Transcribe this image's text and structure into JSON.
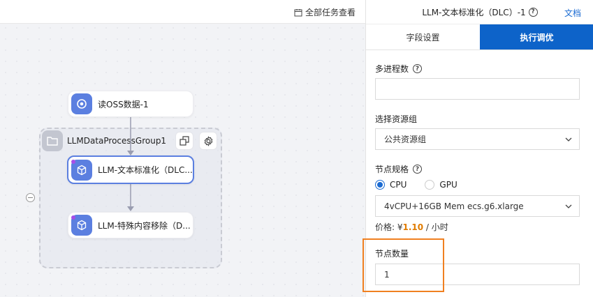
{
  "topbar": {
    "all_tasks": "全部任务查看"
  },
  "canvas": {
    "nodes": [
      {
        "label": "读OSS数据-1"
      },
      {
        "label": "LLM-文本标准化（DLC..."
      },
      {
        "label": "LLM-特殊内容移除（D..."
      }
    ],
    "group": {
      "title": "LLMDataProcessGroup1"
    }
  },
  "panel": {
    "title": "LLM-文本标准化（DLC）-1",
    "doc_link": "文档",
    "tabs": [
      {
        "label": "字段设置",
        "active": false
      },
      {
        "label": "执行调优",
        "active": true
      }
    ],
    "processes": {
      "label": "多进程数",
      "value": ""
    },
    "resource_group": {
      "label": "选择资源组",
      "value": "公共资源组"
    },
    "node_spec": {
      "label": "节点规格",
      "options": [
        "CPU",
        "GPU"
      ],
      "selected": "CPU",
      "value": "4vCPU+16GB Mem ecs.g6.xlarge"
    },
    "price": {
      "prefix": "价格: ¥",
      "amount": "1.10",
      "suffix": " / 小时"
    },
    "node_count": {
      "label": "节点数量",
      "value": "1"
    }
  },
  "colors": {
    "accent": "#0d63c9",
    "highlight": "#f08020",
    "node_icon": "#5b7fe0"
  }
}
